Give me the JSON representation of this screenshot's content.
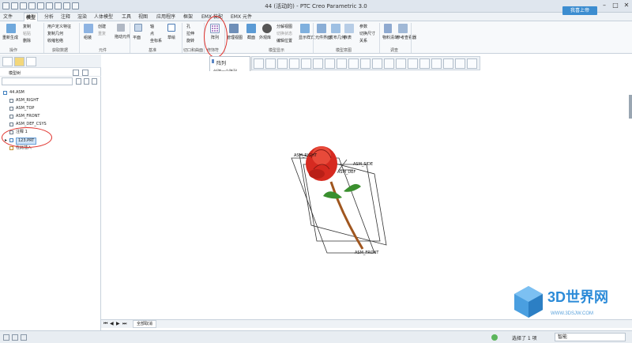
{
  "window": {
    "title": "44 (活动的) - PTC Creo Parametric 3.0",
    "login_label": "我喜上帝"
  },
  "menu": {
    "tabs": [
      "文件",
      "模型",
      "分析",
      "注释",
      "渲染",
      "人体模型",
      "工具",
      "视图",
      "应用程序",
      "框架",
      "EMX 装配",
      "EMX 元件"
    ],
    "active_index": 1
  },
  "ribbon": {
    "operations": {
      "regenerate": "重新生成",
      "copy": "复制",
      "paste": "粘贴",
      "delete": "删除",
      "group_label": "操作"
    },
    "get_data": {
      "user_defined_feature": "用户定义特征",
      "copy_geometry": "复制几何",
      "shrinkwrap": "收缩包络",
      "group_label": "获取数据"
    },
    "component": {
      "assemble": "组装",
      "create": "创建",
      "repeat": "重复",
      "drag_component": "拖动元件",
      "group_label": "元件"
    },
    "datum": {
      "plane": "平面",
      "axis": "轴",
      "point": "点",
      "csys": "坐标系",
      "sketch": "草绘",
      "group_label": "基准"
    },
    "cut_surface": {
      "hole": "孔",
      "extrude": "拉伸",
      "revolve": "旋转",
      "group_label": "切口和曲面"
    },
    "modifiers": {
      "pattern": "阵列",
      "group_label": "修饰符"
    },
    "model_display": {
      "manage_views": "管理视图",
      "section": "截面",
      "appearance": "外观库",
      "exploded_view": "分解视图",
      "edit_position": "编辑位置",
      "toggle_status": "切换状态",
      "display_style": "显示样式",
      "group_label": "模型显示"
    },
    "model_intent": {
      "component_interface": "元件界面",
      "publish_geometry": "发布几何",
      "family_table": "族表",
      "parameters": "参数",
      "switch_sizes": "切换尺寸",
      "relations": "关系",
      "group_label": "模型意图"
    },
    "investigate": {
      "bill_of_materials": "物料清单",
      "reference_viewer": "参考查看器",
      "group_label": "调查"
    }
  },
  "tooltip": {
    "title": "阵列",
    "description": "创建一个阵列。"
  },
  "model_tree": {
    "header": "模型树",
    "items": [
      {
        "label": "44.ASM",
        "indent": 0,
        "icon": "assembly-icon",
        "color": "#3f7fbf"
      },
      {
        "label": "ASM_RIGHT",
        "indent": 1,
        "icon": "datum-plane-icon",
        "color": "#6a7b8c"
      },
      {
        "label": "ASM_TOP",
        "indent": 1,
        "icon": "datum-plane-icon",
        "color": "#6a7b8c"
      },
      {
        "label": "ASM_FRONT",
        "indent": 1,
        "icon": "datum-plane-icon",
        "color": "#6a7b8c"
      },
      {
        "label": "ASM_DEF_CSYS",
        "indent": 1,
        "icon": "csys-icon",
        "color": "#6a7b8c"
      },
      {
        "label": "注释 1",
        "indent": 1,
        "icon": "note-icon",
        "color": "#6a7b8c"
      },
      {
        "label": "123.PRT",
        "indent": 1,
        "icon": "part-icon",
        "color": "#3f7fbf",
        "selected": true
      },
      {
        "label": "在此插入",
        "indent": 1,
        "icon": "insert-here-icon",
        "color": "#c58a2b"
      }
    ]
  },
  "canvas": {
    "labels": [
      "ASM_RIGHT",
      "ASM_SIDE",
      "ASM_DEF",
      "ASM_FRONT"
    ]
  },
  "bottom": {
    "tab_label": "全部取消",
    "status": "选择了 1 项",
    "filter": "智能"
  },
  "watermark": {
    "brand": "3D世界网",
    "url": "WWW.3DSJW.COM"
  },
  "colors": {
    "accent": "#3c8dd0",
    "annotation": "#e0302a",
    "rose": "#d62a20",
    "stem": "#3a8f2e"
  }
}
